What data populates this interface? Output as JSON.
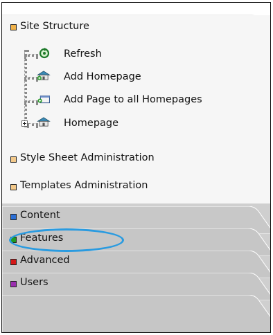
{
  "sections": {
    "site_structure": {
      "label": "Site Structure",
      "color": "#f0b24a"
    },
    "stylesheet_admin": {
      "label": "Style Sheet Administration",
      "color": "#f3c98a"
    },
    "templates_admin": {
      "label": "Templates Administration",
      "color": "#f3c98a"
    }
  },
  "tree": {
    "items": [
      {
        "label": "Refresh",
        "icon": "refresh-icon"
      },
      {
        "label": "Add Homepage",
        "icon": "add-homepage-icon"
      },
      {
        "label": "Add Page to all Homepages",
        "icon": "add-page-icon"
      },
      {
        "label": "Homepage",
        "icon": "homepage-icon"
      }
    ]
  },
  "tabs": [
    {
      "label": "Content",
      "color": "#2b6fd6"
    },
    {
      "label": "Features",
      "color": "#1f9a1f"
    },
    {
      "label": "Advanced",
      "color": "#d41818"
    },
    {
      "label": "Users",
      "color": "#9b2fb0"
    }
  ],
  "highlight_color": "#2a9be0"
}
